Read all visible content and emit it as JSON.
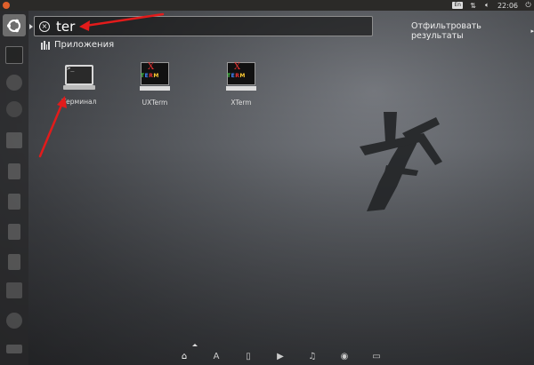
{
  "panel": {
    "keyboard_layout": "En",
    "time": "22:06"
  },
  "search": {
    "query": "ter",
    "filter_label": "Отфильтровать результаты"
  },
  "category": {
    "title": "Приложения"
  },
  "results": [
    {
      "label": "Терминал",
      "icon": "terminal-icon"
    },
    {
      "label": "UXTerm",
      "icon": "xterm-icon"
    },
    {
      "label": "XTerm",
      "icon": "xterm-icon"
    }
  ],
  "launcher_icons": [
    "ubuntu-dash-icon",
    "terminal-icon",
    "firefox-icon",
    "thunderbird-icon",
    "files-icon",
    "document-icon",
    "document-icon",
    "spreadsheet-icon",
    "presentation-icon",
    "font-icon",
    "amazon-icon",
    "settings-icon",
    "disk-icon"
  ],
  "lenses": [
    "home-lens-icon",
    "apps-lens-icon",
    "files-lens-icon",
    "video-lens-icon",
    "music-lens-icon",
    "photo-lens-icon",
    "social-lens-icon"
  ],
  "colors": {
    "accent": "#e0602b",
    "arrow": "#e21b1b"
  }
}
